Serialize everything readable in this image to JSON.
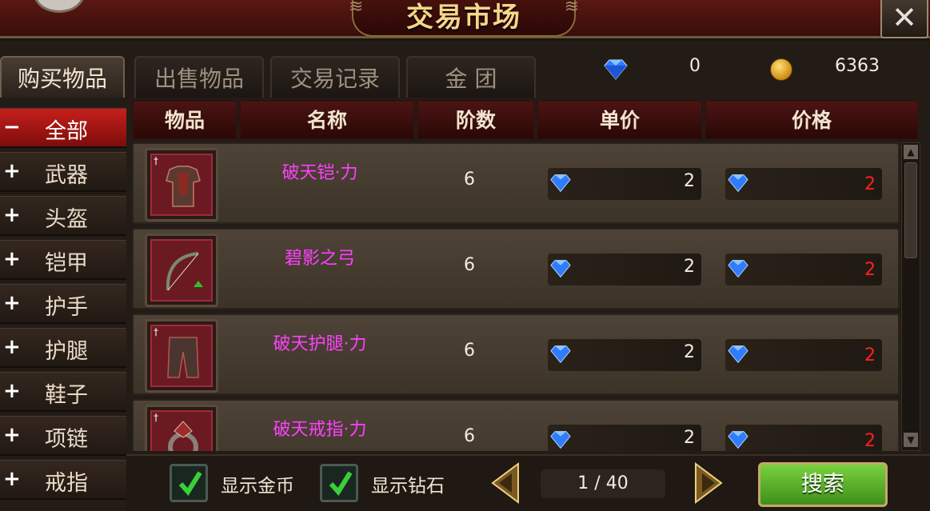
{
  "window": {
    "title": "交易市场",
    "close_icon": "close-x-icon"
  },
  "tabs": [
    {
      "label": "购买物品",
      "active": true
    },
    {
      "label": "出售物品",
      "active": false
    },
    {
      "label": "交易记录",
      "active": false
    },
    {
      "label": "金 团",
      "active": false
    }
  ],
  "currency": {
    "diamond": "0",
    "gold": "6363"
  },
  "sidebar": [
    {
      "symbol": "−",
      "label": "全部",
      "active": true
    },
    {
      "symbol": "+",
      "label": "武器",
      "active": false
    },
    {
      "symbol": "+",
      "label": "头盔",
      "active": false
    },
    {
      "symbol": "+",
      "label": "铠甲",
      "active": false
    },
    {
      "symbol": "+",
      "label": "护手",
      "active": false
    },
    {
      "symbol": "+",
      "label": "护腿",
      "active": false
    },
    {
      "symbol": "+",
      "label": "鞋子",
      "active": false
    },
    {
      "symbol": "+",
      "label": "项链",
      "active": false
    },
    {
      "symbol": "+",
      "label": "戒指",
      "active": false
    }
  ],
  "table": {
    "headers": [
      "物品",
      "名称",
      "阶数",
      "单价",
      "价格"
    ],
    "rows": [
      {
        "icon": "armor-icon",
        "name": "破天铠·力",
        "tier": "6",
        "unit_price": "2",
        "price": "2"
      },
      {
        "icon": "bow-icon",
        "name": "碧影之弓",
        "tier": "6",
        "unit_price": "2",
        "price": "2"
      },
      {
        "icon": "leggings-icon",
        "name": "破天护腿·力",
        "tier": "6",
        "unit_price": "2",
        "price": "2"
      },
      {
        "icon": "ring-icon",
        "name": "破天戒指·力",
        "tier": "6",
        "unit_price": "2",
        "price": "2"
      }
    ]
  },
  "footer": {
    "show_gold_label": "显示金币",
    "show_diamond_label": "显示钻石",
    "show_gold_checked": true,
    "show_diamond_checked": true,
    "page": "1 / 40",
    "search_label": "搜索"
  },
  "colors": {
    "item_name": "#ff40ff",
    "price_red": "#ff2020",
    "diamond": "#2f7cff",
    "search_green": "#5cb82c"
  }
}
